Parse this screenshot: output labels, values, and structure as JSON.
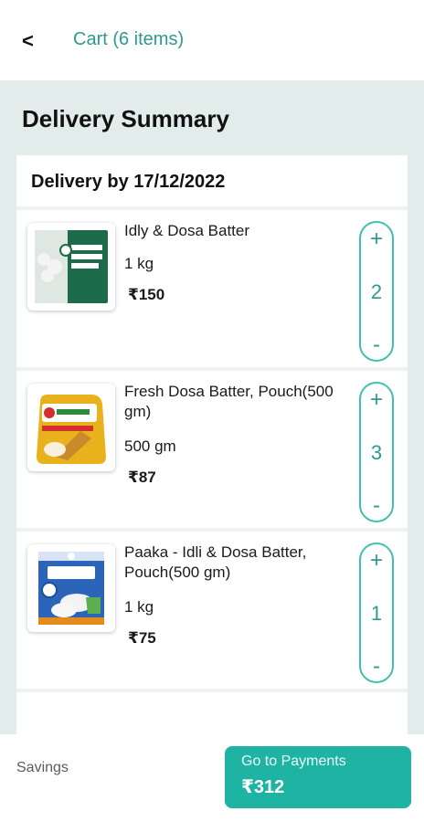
{
  "header": {
    "back_label": "<",
    "title": "Cart (6 items)"
  },
  "summary": {
    "title": "Delivery Summary",
    "delivery_date": "Delivery by 17/12/2022"
  },
  "items": [
    {
      "name": "Idly & Dosa Batter",
      "qty_label": "1 kg",
      "price": "₹150",
      "count": "2",
      "image": "idly-dosa-batter-pack"
    },
    {
      "name": "Fresh Dosa Batter, Pouch(500 gm)",
      "qty_label": "500 gm",
      "price": "₹87",
      "count": "3",
      "image": "fresh-dosa-batter-pouch"
    },
    {
      "name": "Paaka - Idli & Dosa Batter, Pouch(500 gm)",
      "qty_label": "1 kg",
      "price": "₹75",
      "count": "1",
      "image": "paaka-batter-pouch"
    }
  ],
  "stepper": {
    "plus": "+",
    "minus": "-"
  },
  "footer": {
    "savings_label": "Savings",
    "pay_label": "Go to Payments",
    "pay_amount": "₹312"
  },
  "colors": {
    "accent": "#1fb3a4",
    "accent_text": "#2e9a8e",
    "background": "#e2ecea"
  }
}
